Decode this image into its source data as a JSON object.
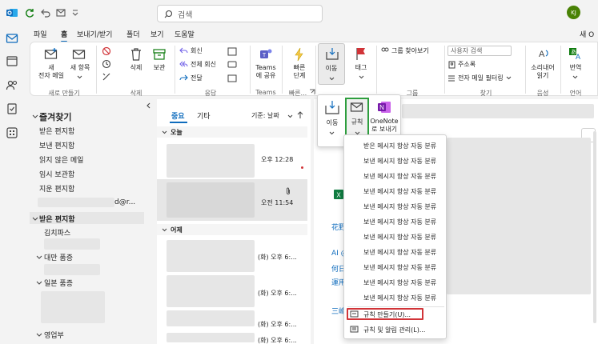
{
  "titlebar": {
    "search_placeholder": "검색",
    "avatar_initials": "KJ"
  },
  "tabs": [
    {
      "label": "파일"
    },
    {
      "label": "홈"
    },
    {
      "label": "보내기/받기"
    },
    {
      "label": "폴더"
    },
    {
      "label": "보기"
    },
    {
      "label": "도움말"
    }
  ],
  "tab_right": "새 O",
  "ribbon": {
    "new_mail": "새\n전자 메일",
    "new_items": "새 항목",
    "group_new": "새로 만들기",
    "delete": "삭제",
    "archive": "보관",
    "group_delete": "삭제",
    "reply": "회신",
    "reply_all": "전체 회신",
    "forward": "전달",
    "group_respond": "응답",
    "teams_share": "Teams\n에 공유",
    "group_teams": "Teams",
    "quick_steps": "빠른\n단계",
    "group_quick": "빠른...",
    "move": "이동",
    "tags": "태그",
    "find_group": "그룹 찾아보기",
    "group_group": "그룹",
    "search_people": "사용자 검색",
    "address_book": "주소록",
    "filter_mail": "전자 메일 필터링",
    "group_find": "찾기",
    "read_aloud": "소리내어\n읽기",
    "group_voice": "음성",
    "translate": "번역",
    "group_lang": "언어"
  },
  "folders": {
    "favorites": "즐겨찾기",
    "fav_items": [
      "받은 편지함",
      "보낸 편지함",
      "읽지 않은 메일",
      "임시 보관함",
      "지운 편지함"
    ],
    "account_suffix": "d@r...",
    "inbox": "받은 편지함",
    "sub1": "김치파스",
    "sub2": "대만 품증",
    "sub3": "일본 품증",
    "sub4": "영업부"
  },
  "msglist": {
    "tab_focused": "중요",
    "tab_other": "기타",
    "sort": "기준: 날짜",
    "section_today": "오늘",
    "section_yesterday": "어제",
    "times": [
      "오후 12:28",
      "오전 11:54",
      "(화) 오후 6:...",
      "(화) 오후 6:...",
      "(화) 오후 6:...",
      "(화) 오후 6:..."
    ]
  },
  "reading": {
    "snippets": [
      "花野",
      "AI @",
      "何日",
      "運用",
      "三峰"
    ]
  },
  "move_flyout": {
    "move": "이동",
    "rules": "규칙",
    "onenote": "OneNote\n로 보내기"
  },
  "rules_menu": {
    "items": [
      "받은 메시지 항상 자동 분류",
      "보낸 메시지 항상 자동 분류",
      "보낸 메시지 항상 자동 분류",
      "보낸 메시지 항상 자동 분류",
      "보낸 메시지 항상 자동 분류",
      "보낸 메시지 항상 자동 분류",
      "보낸 메시지 항상 자동 분류",
      "보낸 메시지 항상 자동 분류",
      "보낸 메시지 항상 자동 분류",
      "보낸 메시지 항상 자동 분류",
      "보낸 메시지 항상 자동 분류"
    ],
    "create_rule": "규칙 만들기(U)...",
    "manage_rules": "규칙 및 알림 관리(L)..."
  },
  "colors": {
    "accent": "#0f6cbd",
    "highlight_green": "#2e9e3e",
    "highlight_red": "#d13438"
  }
}
